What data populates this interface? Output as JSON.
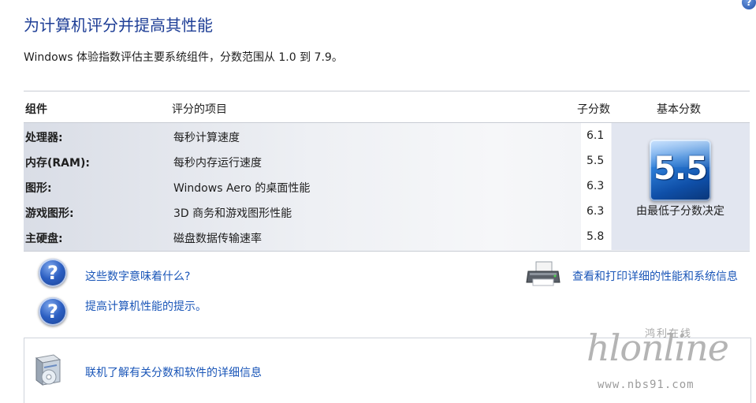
{
  "header": {
    "help_glyph": "?",
    "title": "为计算机评分并提高其性能",
    "subtitle": "Windows 体验指数评估主要系统组件，分数范围从 1.0 到 7.9。"
  },
  "table": {
    "columns": {
      "component": "组件",
      "item": "评分的项目",
      "subscore": "子分数",
      "base": "基本分数"
    },
    "rows": [
      {
        "component": "处理器:",
        "item": "每秒计算速度",
        "score": "6.1"
      },
      {
        "component": "内存(RAM):",
        "item": "每秒内存运行速度",
        "score": "5.5"
      },
      {
        "component": "图形:",
        "item": "Windows Aero 的桌面性能",
        "score": "6.3"
      },
      {
        "component": "游戏图形:",
        "item": "3D 商务和游戏图形性能",
        "score": "6.3"
      },
      {
        "component": "主硬盘:",
        "item": "磁盘数据传输速率",
        "score": "5.8"
      }
    ],
    "base_score": "5.5",
    "base_caption": "由最低子分数决定"
  },
  "links": {
    "what_mean": "这些数字意味着什么?",
    "tips": "提高计算机性能的提示。",
    "print_details": "查看和打印详细的性能和系统信息",
    "online_info": "联机了解有关分数和软件的详细信息"
  },
  "icons": {
    "help": "help-icon",
    "question": "question-icon",
    "printer": "printer-icon",
    "software_box": "software-box-icon"
  },
  "watermark": {
    "cn": "鸿利在线",
    "main": "hlonline",
    "url": "www.nbs91.com"
  },
  "colors": {
    "title": "#1e3e96",
    "link": "#1a56b8",
    "badge": "#2d7ed8"
  }
}
